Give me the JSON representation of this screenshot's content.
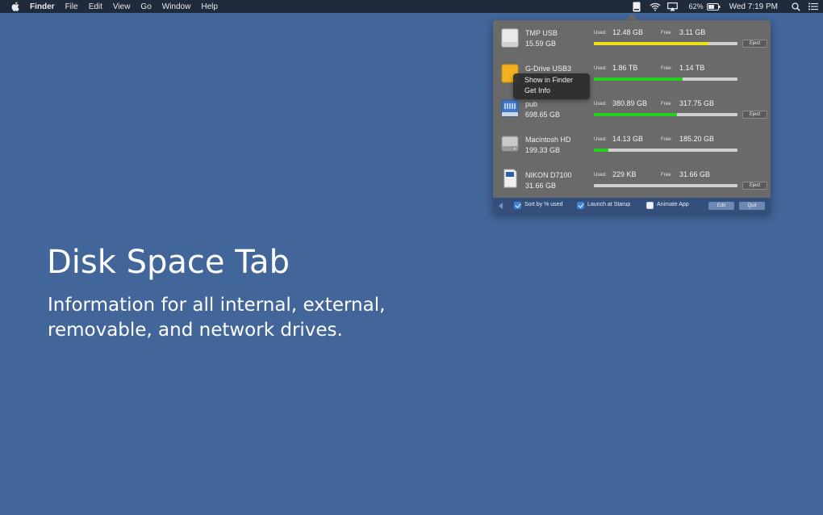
{
  "menubar": {
    "app_name": "Finder",
    "menus": [
      "File",
      "Edit",
      "View",
      "Go",
      "Window",
      "Help"
    ],
    "battery_percent": "62%",
    "clock": "Wed 7:19 PM",
    "icons": [
      "apple-icon",
      "disk-space-tab-icon",
      "wifi-icon",
      "airplay-icon",
      "battery-icon",
      "search-icon",
      "list-icon"
    ]
  },
  "drives": [
    {
      "name": "TMP USB",
      "size": "15.59 GB",
      "used_label": "Used:",
      "used": "12.48 GB",
      "free_label": "Free:",
      "free": "3.11 GB",
      "used_fraction": 0.8,
      "bar_color": "#f0e01a",
      "eject": "Eject",
      "icon": "usb-drive-icon"
    },
    {
      "name": "G-Drive USB3",
      "size": "",
      "used_label": "Used:",
      "used": "1.86 TB",
      "free_label": "Free:",
      "free": "1.14 TB",
      "used_fraction": 0.62,
      "bar_color": "#22d11f",
      "eject": "",
      "icon": "external-drive-icon"
    },
    {
      "name": "pub",
      "size": "698.65 GB",
      "used_label": "Used:",
      "used": "380.89 GB",
      "free_label": "Free:",
      "free": "317.75 GB",
      "used_fraction": 0.58,
      "bar_color": "#22d11f",
      "eject": "Eject",
      "icon": "network-drive-icon"
    },
    {
      "name": "Macintosh HD",
      "size": "199.33 GB",
      "used_label": "Used:",
      "used": "14.13 GB",
      "free_label": "Free:",
      "free": "185.20 GB",
      "used_fraction": 0.1,
      "bar_color": "#22d11f",
      "eject": "",
      "icon": "internal-drive-icon"
    },
    {
      "name": "NIKON D7100",
      "size": "31.66 GB",
      "used_label": "Used:",
      "used": "229 KB",
      "free_label": "Free:",
      "free": "31.66 GB",
      "used_fraction": 0.0,
      "bar_color": "#22d11f",
      "eject": "Eject",
      "icon": "sd-card-icon"
    }
  ],
  "context_menu": {
    "items": [
      "Show in Finder",
      "Get Info"
    ]
  },
  "footer": {
    "sort_label": "Sort by % used",
    "sort_checked": true,
    "launch_label": "Launch at Starup",
    "launch_checked": true,
    "animate_label": "Animate App",
    "animate_checked": false,
    "edit_label": "Edit",
    "quit_label": "Quit"
  },
  "hero": {
    "title": "Disk Space Tab",
    "subtitle": "Information for all internal, external, removable, and network drives."
  },
  "colors": {
    "desktop": "#42659a",
    "menubar": "#1f2a3a",
    "popover": "#6a6a6a",
    "footer": "#344f7c",
    "yellow_bar": "#f0e01a",
    "green_bar": "#22d11f"
  }
}
